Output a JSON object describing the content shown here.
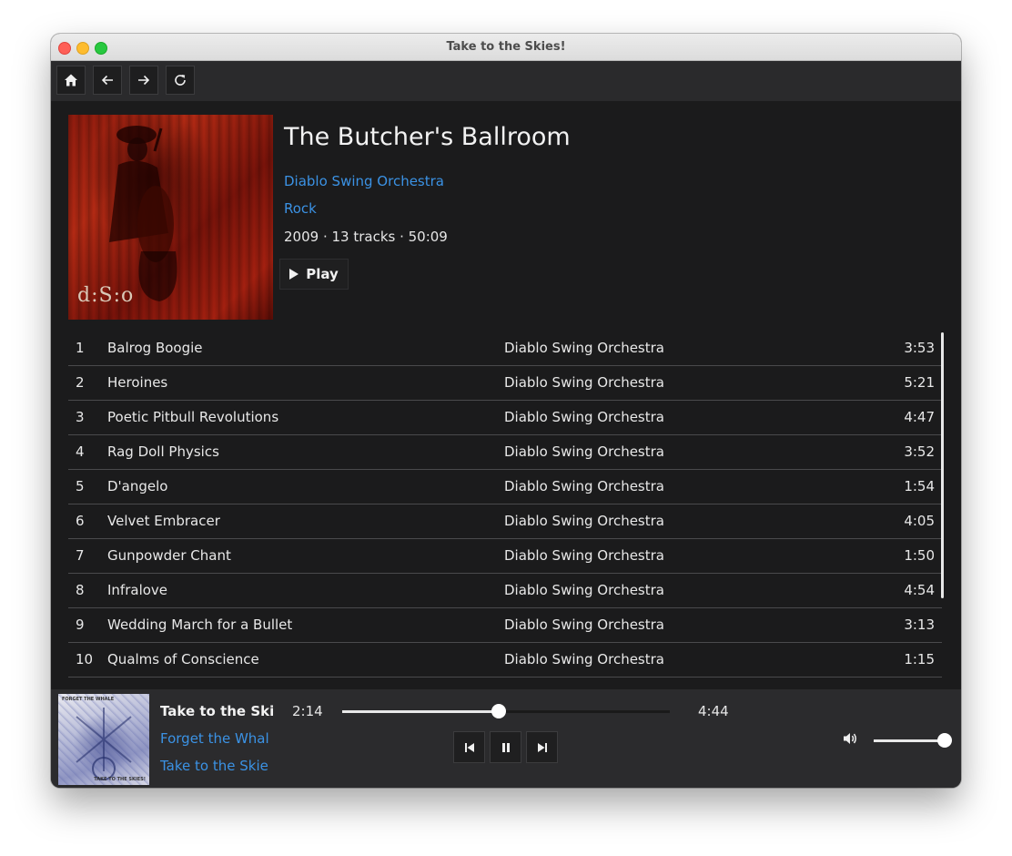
{
  "window": {
    "title": "Take to the Skies!"
  },
  "toolbar": {
    "icons": [
      "home-icon",
      "arrow-left-icon",
      "arrow-right-icon",
      "refresh-icon"
    ]
  },
  "album": {
    "title": "The Butcher's Ballroom",
    "artist": "Diablo Swing Orchestra",
    "genre": "Rock",
    "meta": "2009 · 13 tracks ·  50:09",
    "cover_text": "d:S:o",
    "play_label": "Play"
  },
  "tracks": [
    {
      "num": "1",
      "title": "Balrog Boogie",
      "artist": "Diablo Swing Orchestra",
      "duration": "3:53"
    },
    {
      "num": "2",
      "title": "Heroines",
      "artist": "Diablo Swing Orchestra",
      "duration": "5:21"
    },
    {
      "num": "3",
      "title": "Poetic Pitbull Revolutions",
      "artist": "Diablo Swing Orchestra",
      "duration": "4:47"
    },
    {
      "num": "4",
      "title": "Rag Doll Physics",
      "artist": "Diablo Swing Orchestra",
      "duration": "3:52"
    },
    {
      "num": "5",
      "title": "D'angelo",
      "artist": "Diablo Swing Orchestra",
      "duration": "1:54"
    },
    {
      "num": "6",
      "title": "Velvet Embracer",
      "artist": "Diablo Swing Orchestra",
      "duration": "4:05"
    },
    {
      "num": "7",
      "title": "Gunpowder Chant",
      "artist": "Diablo Swing Orchestra",
      "duration": "1:50"
    },
    {
      "num": "8",
      "title": "Infralove",
      "artist": "Diablo Swing Orchestra",
      "duration": "4:54"
    },
    {
      "num": "9",
      "title": "Wedding March for a Bullet",
      "artist": "Diablo Swing Orchestra",
      "duration": "3:13"
    },
    {
      "num": "10",
      "title": "Qualms of Conscience",
      "artist": "Diablo Swing Orchestra",
      "duration": "1:15"
    }
  ],
  "now_playing": {
    "title": "Take to the Ski",
    "artist": "Forget the Whal",
    "album": "Take to the Skie",
    "cover_top_text": "FORGET THE WHALE",
    "cover_bottom_text": "TAKE TO THE SKIES!",
    "elapsed": "2:14",
    "total": "4:44",
    "progress": 0.477,
    "volume": 1.0
  },
  "colors": {
    "accent_link": "#3b92e4",
    "background": "#1b1b1c",
    "player_bar": "#2b2b2d"
  }
}
